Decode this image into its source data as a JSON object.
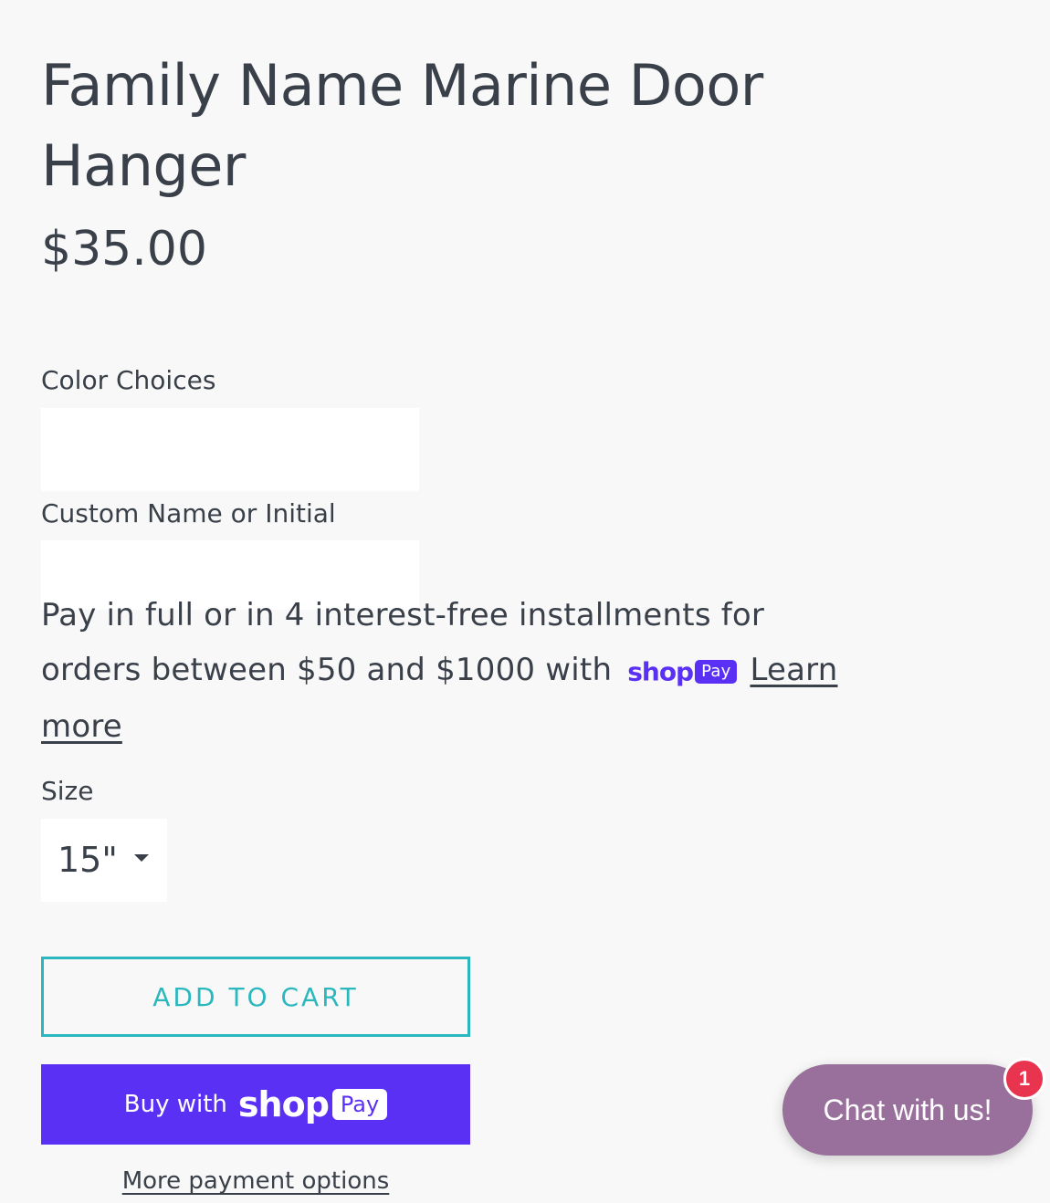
{
  "product": {
    "title": "Family Name Marine Door Hanger",
    "price": "$35.00"
  },
  "options": {
    "color_label": "Color Choices",
    "color_value": "",
    "custom_name_label": "Custom Name or Initial",
    "custom_name_value": "",
    "size_label": "Size",
    "size_selected": "15\""
  },
  "installments": {
    "text": "Pay in full or in 4 interest-free installments for orders between $50 and $1000 with",
    "logo_shop": "shop",
    "logo_pay": "Pay",
    "learn_more": "Learn more"
  },
  "actions": {
    "add_to_cart": "ADD TO CART",
    "buy_with": "Buy with",
    "shop_word": "shop",
    "pay_word": "Pay",
    "more_payment_options": "More payment options"
  },
  "chat": {
    "label": "Chat with us!",
    "badge_count": "1"
  },
  "colors": {
    "text": "#3a4049",
    "accent_teal": "#2ab7bd",
    "shop_pay_purple": "#5a31f4",
    "chat_purple": "#98709b",
    "badge_red": "#e8344e",
    "background": "#f8f8f8"
  }
}
